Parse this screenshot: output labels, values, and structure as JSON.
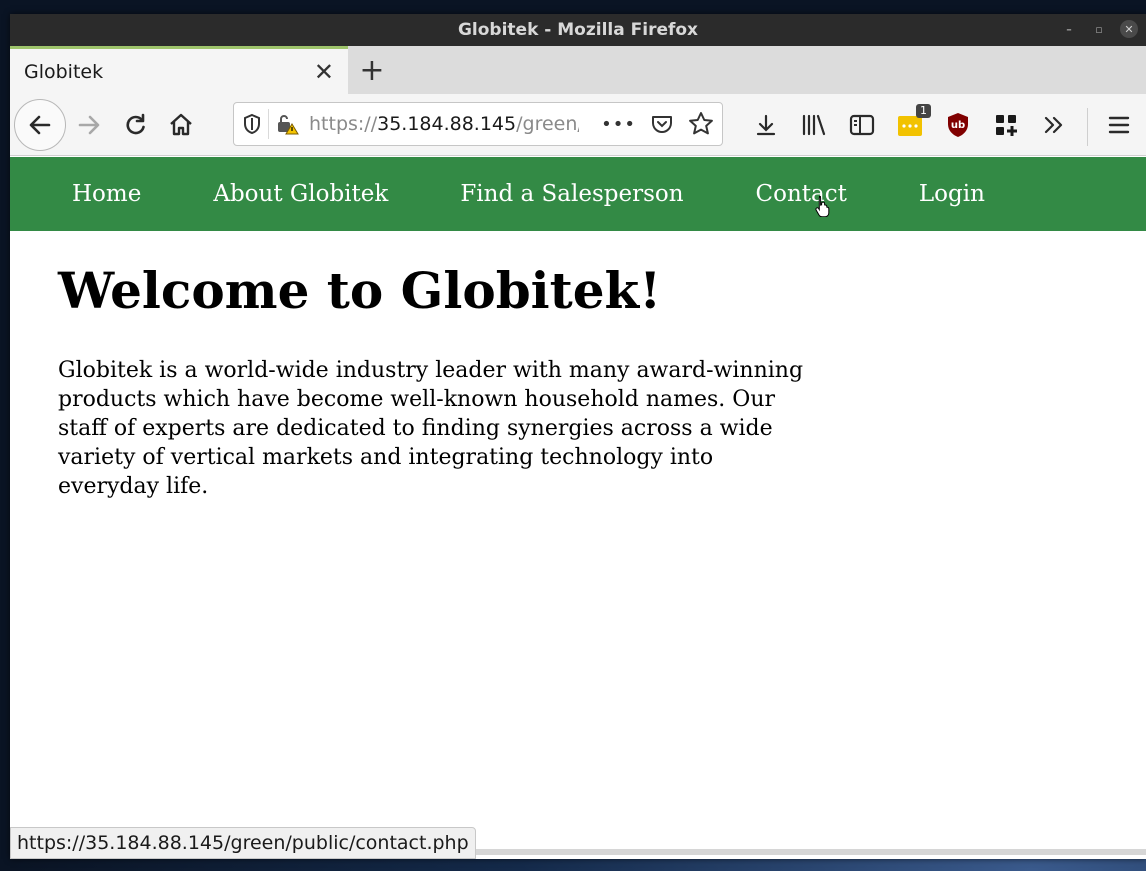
{
  "window": {
    "title": "Globitek - Mozilla Firefox",
    "controls": [
      "minimize",
      "maximize",
      "close"
    ]
  },
  "tabs": [
    {
      "title": "Globitek",
      "active": true
    }
  ],
  "urlbar": {
    "url_prefix": "https://",
    "url_host": "35.184.88.145",
    "url_rest": "/green/",
    "more_label": "•••"
  },
  "toolbar": {
    "extension_badge": "1"
  },
  "site": {
    "nav": [
      "Home",
      "About Globitek",
      "Find a Salesperson",
      "Contact",
      "Login"
    ],
    "nav_color": "#338a45",
    "heading": "Welcome to Globitek!",
    "intro": "Globitek is a world-wide industry leader with many award-winning products which have become well-known household names. Our staff of experts are dedicated to finding synergies across a wide variety of vertical markets and integrating technology into everyday life."
  },
  "statusbar": {
    "link": "https://35.184.88.145/green/public/contact.php"
  }
}
